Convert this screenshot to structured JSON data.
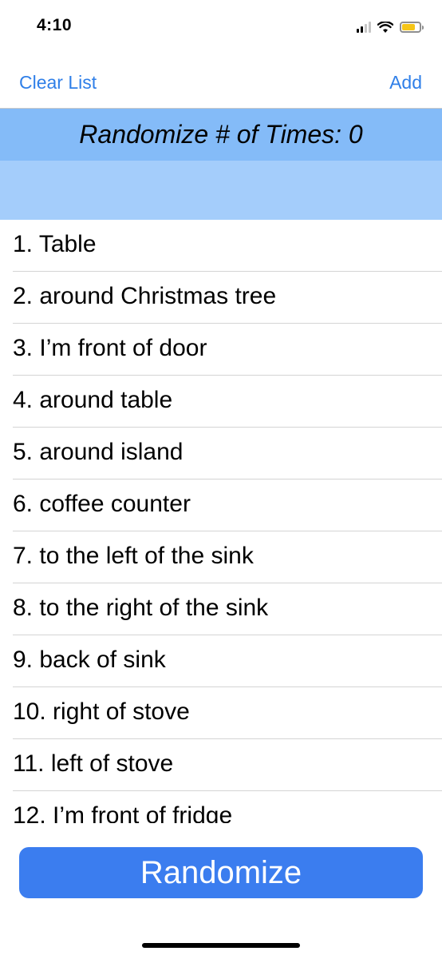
{
  "status_bar": {
    "time": "4:10",
    "battery_level": 0.8,
    "battery_color": "#f5c518"
  },
  "nav": {
    "clear_label": "Clear List",
    "add_label": "Add",
    "accent_color": "#2f7fe8"
  },
  "header": {
    "title": "Randomize # of Times: 0",
    "band_color": "#84bbf8",
    "sub_band_color": "#a4cdfb"
  },
  "list": {
    "items": [
      "1. Table",
      "2. around Christmas tree",
      "3. I’m front of door",
      "4. around table",
      "5. around island",
      "6. coffee counter",
      "7. to the left of the sink",
      "8. to the right of the sink",
      "9. back of sink",
      "10. right of stove",
      "11. left of stove",
      "12. I’m front of fridge"
    ]
  },
  "randomize_button": {
    "label": "Randomize",
    "color": "#3b7def"
  }
}
